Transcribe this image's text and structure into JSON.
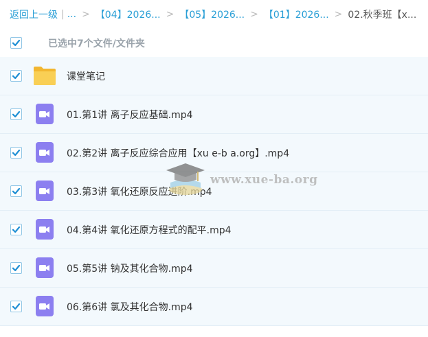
{
  "breadcrumb": {
    "back_label": "返回上一级",
    "ellipsis": "...",
    "crumbs": [
      "【04】2026...",
      "【05】2026...",
      "【01】2026..."
    ],
    "current": "02.秋季班【x..."
  },
  "selection": {
    "text": "已选中7个文件/文件夹",
    "checked": true
  },
  "files": [
    {
      "name": "课堂笔记",
      "type": "folder",
      "checked": true
    },
    {
      "name": "01.第1讲 离子反应基础.mp4",
      "type": "video",
      "checked": true
    },
    {
      "name": "02.第2讲 离子反应综合应用【xu e-b a.org】.mp4",
      "type": "video",
      "checked": true
    },
    {
      "name": "03.第3讲 氧化还原反应进阶.mp4",
      "type": "video",
      "checked": true
    },
    {
      "name": "04.第4讲 氧化还原方程式的配平.mp4",
      "type": "video",
      "checked": true
    },
    {
      "name": "05.第5讲 钠及其化合物.mp4",
      "type": "video",
      "checked": true
    },
    {
      "name": "06.第6讲 氯及其化合物.mp4",
      "type": "video",
      "checked": true
    }
  ],
  "watermark": {
    "text": "www.xue-ba.org",
    "icon": "graduation-cap-icon"
  },
  "colors": {
    "link": "#2a9fd6",
    "row_bg": "#f3f9fd",
    "folder": "#f7c948",
    "video": "#8c7ff0",
    "check": "#1f8fd4"
  }
}
